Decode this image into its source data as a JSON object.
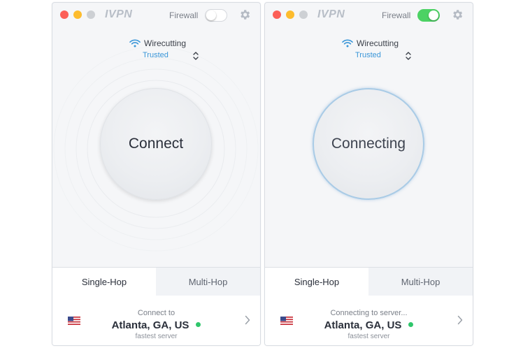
{
  "colors": {
    "accent_blue": "#3a96d8",
    "toggle_on": "#4cd264",
    "status_ok": "#2fc66b",
    "close": "#fc5f57",
    "minimize": "#fdbc2e"
  },
  "windows": [
    {
      "logo": "IVPN",
      "firewall_label": "Firewall",
      "firewall_on": false,
      "network": {
        "name": "Wirecutting",
        "status": "Trusted",
        "icon": "wifi-icon"
      },
      "main_button_label": "Connect",
      "tabs": [
        "Single-Hop",
        "Multi-Hop"
      ],
      "selected_tab": "Single-Hop",
      "server": {
        "status": "Connect to",
        "city": "Atlanta, GA, US",
        "sub": "fastest server",
        "flag": "us-flag-icon"
      }
    },
    {
      "logo": "IVPN",
      "firewall_label": "Firewall",
      "firewall_on": true,
      "network": {
        "name": "Wirecutting",
        "status": "Trusted",
        "icon": "wifi-icon"
      },
      "main_button_label": "Connecting",
      "tabs": [
        "Single-Hop",
        "Multi-Hop"
      ],
      "selected_tab": "Single-Hop",
      "server": {
        "status": "Connecting to server...",
        "city": "Atlanta, GA, US",
        "sub": "fastest server",
        "flag": "us-flag-icon"
      }
    }
  ]
}
